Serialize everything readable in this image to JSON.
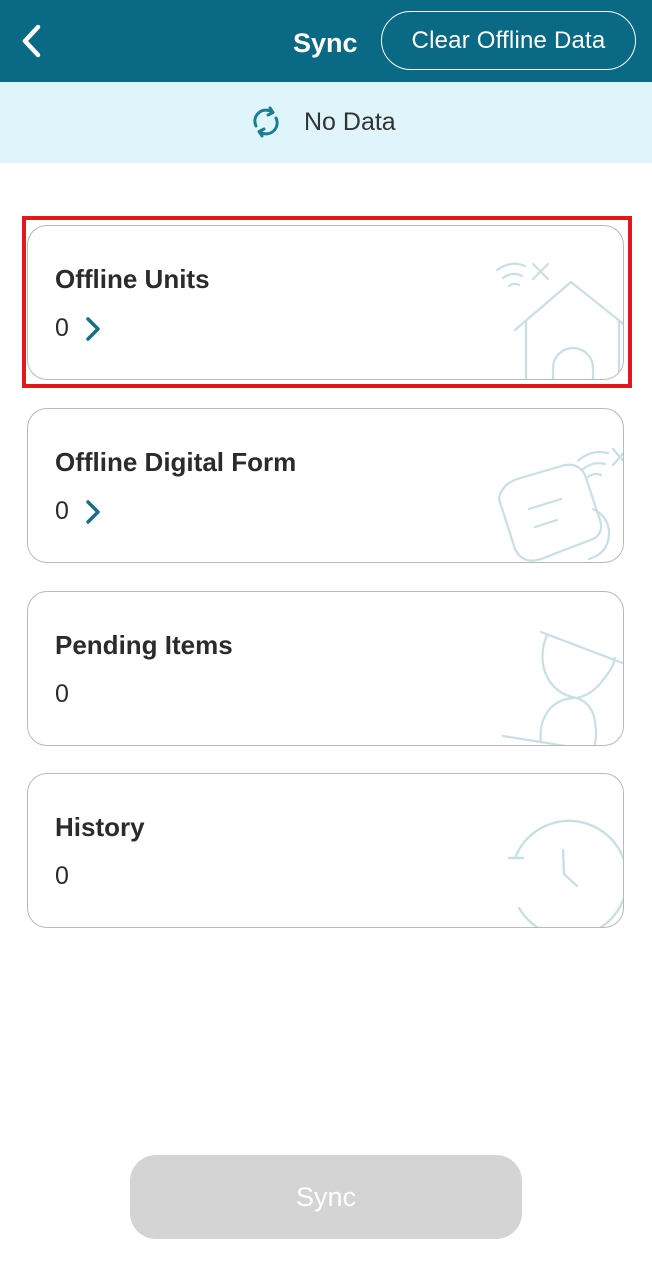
{
  "header": {
    "back_icon": "chevron-left-icon",
    "title": "Sync",
    "clear_button_label": "Clear Offline Data"
  },
  "status": {
    "icon": "sync-icon",
    "text": "No Data"
  },
  "cards": [
    {
      "title": "Offline Units",
      "count": "0",
      "has_chevron": true,
      "illustration": "house-wifi-off-icon"
    },
    {
      "title": "Offline Digital Form",
      "count": "0",
      "has_chevron": true,
      "illustration": "document-wifi-off-icon"
    },
    {
      "title": "Pending Items",
      "count": "0",
      "has_chevron": false,
      "illustration": "hourglass-icon"
    },
    {
      "title": "History",
      "count": "0",
      "has_chevron": false,
      "illustration": "clock-icon"
    }
  ],
  "footer": {
    "sync_button_label": "Sync",
    "sync_button_enabled": false
  },
  "colors": {
    "header_bg": "#0a6a86",
    "status_bg": "#dff5fb",
    "accent": "#1a6f86",
    "illustration_stroke": "#c9dfe6",
    "highlight": "#e3171c",
    "disabled_button": "#d4d4d4"
  }
}
